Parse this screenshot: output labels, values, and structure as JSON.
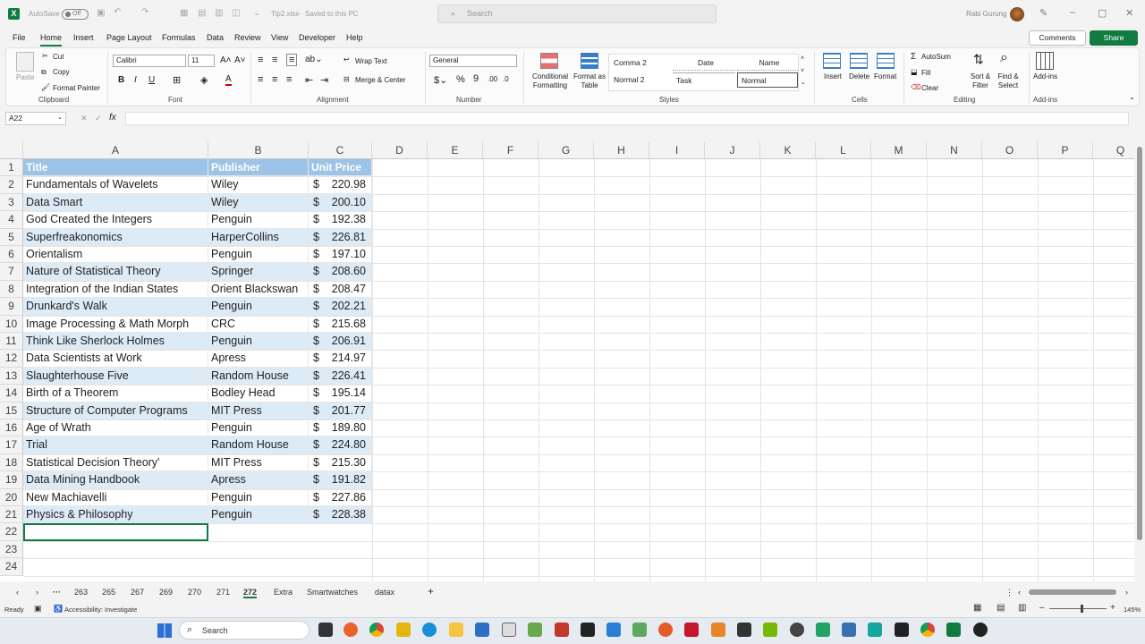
{
  "titlebar": {
    "autosave": "AutoSave",
    "toggle": "Off",
    "filename": "Tip2.xlsx",
    "saved": "Saved to this PC",
    "search": "Search",
    "user": "Rabi Gurung"
  },
  "tabs": [
    "File",
    "Home",
    "Insert",
    "Page Layout",
    "Formulas",
    "Data",
    "Review",
    "View",
    "Developer",
    "Help"
  ],
  "actions": {
    "comments": "Comments",
    "share": "Share"
  },
  "clipboard": {
    "paste": "Paste",
    "cut": "Cut",
    "copy": "Copy",
    "painter": "Format Painter",
    "label": "Clipboard"
  },
  "font": {
    "name": "Calibri",
    "size": "11",
    "label": "Font"
  },
  "alignment": {
    "wrap": "Wrap Text",
    "merge": "Merge & Center",
    "label": "Alignment"
  },
  "number": {
    "format": "General",
    "label": "Number"
  },
  "styles": {
    "conditional": "Conditional Formatting",
    "format_table": "Format as Table",
    "comma2": "Comma 2",
    "date": "Date",
    "name": "Name",
    "normal2": "Normal 2",
    "task": "Task",
    "normal": "Normal",
    "label": "Styles"
  },
  "cells": {
    "insert": "Insert",
    "delete": "Delete",
    "format": "Format",
    "label": "Cells"
  },
  "editing": {
    "autosum": "AutoSum",
    "fill": "Fill",
    "clear": "Clear",
    "sort": "Sort & Filter",
    "find": "Find & Select",
    "label": "Editing"
  },
  "addins": {
    "btn": "Add-ins",
    "label": "Add-ins"
  },
  "namebox": "A22",
  "fx": "fx",
  "columns": [
    "A",
    "B",
    "C",
    "D",
    "E",
    "F",
    "G",
    "H",
    "I",
    "J",
    "K",
    "L",
    "M",
    "N",
    "O",
    "P",
    "Q"
  ],
  "header_row": [
    "Title",
    "Publisher",
    "Unit Price"
  ],
  "rows": [
    [
      "Fundamentals of Wavelets",
      "Wiley",
      "220.98"
    ],
    [
      "Data Smart",
      "Wiley",
      "200.10"
    ],
    [
      "God Created the Integers",
      "Penguin",
      "192.38"
    ],
    [
      "Superfreakonomics",
      "HarperCollins",
      "226.81"
    ],
    [
      "Orientalism",
      "Penguin",
      "197.10"
    ],
    [
      "Nature of Statistical Theory",
      "Springer",
      "208.60"
    ],
    [
      "Integration of the Indian States",
      "Orient Blackswan",
      "208.47"
    ],
    [
      "Drunkard's Walk",
      "Penguin",
      "202.21"
    ],
    [
      "Image Processing & Math Morph",
      "CRC",
      "215.68"
    ],
    [
      "Think Like Sherlock Holmes",
      "Penguin",
      "206.91"
    ],
    [
      "Data Scientists at Work",
      "Apress",
      "214.97"
    ],
    [
      "Slaughterhouse Five",
      "Random House",
      "226.41"
    ],
    [
      "Birth of a Theorem",
      "Bodley Head",
      "195.14"
    ],
    [
      "Structure of Computer Programs",
      "MIT Press",
      "201.77"
    ],
    [
      "Age of Wrath",
      "Penguin",
      "189.80"
    ],
    [
      "Trial",
      "Random House",
      "224.80"
    ],
    [
      "Statistical Decision Theory'",
      "MIT Press",
      "215.30"
    ],
    [
      "Data Mining Handbook",
      "Apress",
      "191.82"
    ],
    [
      "New Machiavelli",
      "Penguin",
      "227.86"
    ],
    [
      "Physics & Philosophy",
      "Penguin",
      "228.38"
    ]
  ],
  "currency": "$",
  "row_numbers": [
    "1",
    "2",
    "3",
    "4",
    "5",
    "6",
    "7",
    "8",
    "9",
    "10",
    "11",
    "12",
    "13",
    "14",
    "15",
    "16",
    "17",
    "18",
    "19",
    "20",
    "21",
    "22",
    "23",
    "24"
  ],
  "sheets": [
    "263",
    "265",
    "267",
    "269",
    "270",
    "271",
    "272",
    "Extra",
    "Smartwatches",
    "datax"
  ],
  "status": {
    "ready": "Ready",
    "accessibility": "Accessibility: Investigate",
    "zoom": "145%"
  },
  "taskbar": {
    "search": "Search"
  }
}
